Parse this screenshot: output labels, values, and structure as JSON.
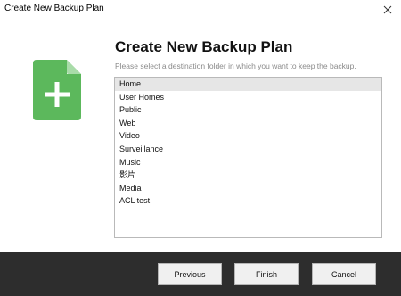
{
  "window": {
    "title": "Create New Backup Plan",
    "close_icon": "close-icon"
  },
  "icon": {
    "name": "new-document-icon",
    "color": "#5cb85c"
  },
  "main": {
    "heading": "Create New Backup Plan",
    "subtitle": "Please select a destination folder in which you want to keep the backup.",
    "folders": [
      "Home",
      "User Homes",
      "Public",
      "Web",
      "Video",
      "Surveillance",
      "Music",
      "影片",
      "Media",
      "ACL test"
    ],
    "selected_folder": "Home"
  },
  "footer": {
    "previous_label": "Previous",
    "finish_label": "Finish",
    "cancel_label": "Cancel"
  },
  "colors": {
    "footer_bg": "#2d2d2d",
    "selection_bg": "#e6e6e6"
  }
}
